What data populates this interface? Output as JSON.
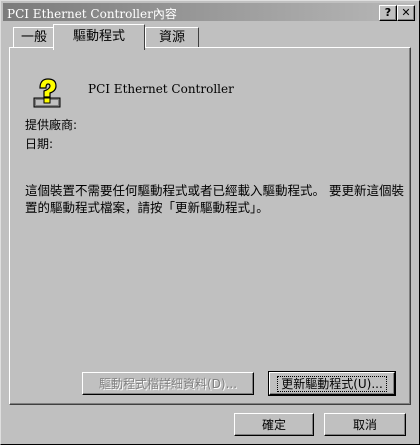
{
  "window": {
    "title": "PCI Ethernet Controller內容",
    "help_button": "?",
    "close_button": "✕"
  },
  "tabs": [
    {
      "label": "一般"
    },
    {
      "label": "驅動程式"
    },
    {
      "label": "資源"
    }
  ],
  "driver": {
    "device_name": "PCI Ethernet Controller",
    "provider_label": "提供廠商:",
    "date_label": "日期:",
    "description": "這個裝置不需要任何驅動程式或者已經載入驅動程式。 要更新這個裝置的驅動程式檔案，請按「更新驅動程式」。",
    "details_button": "驅動程式檔詳細資料(D)...",
    "update_button": "更新驅動程式(U)..."
  },
  "footer": {
    "ok_button": "確定",
    "cancel_button": "取消"
  },
  "icons": {
    "device": "question-mark-device-icon"
  }
}
